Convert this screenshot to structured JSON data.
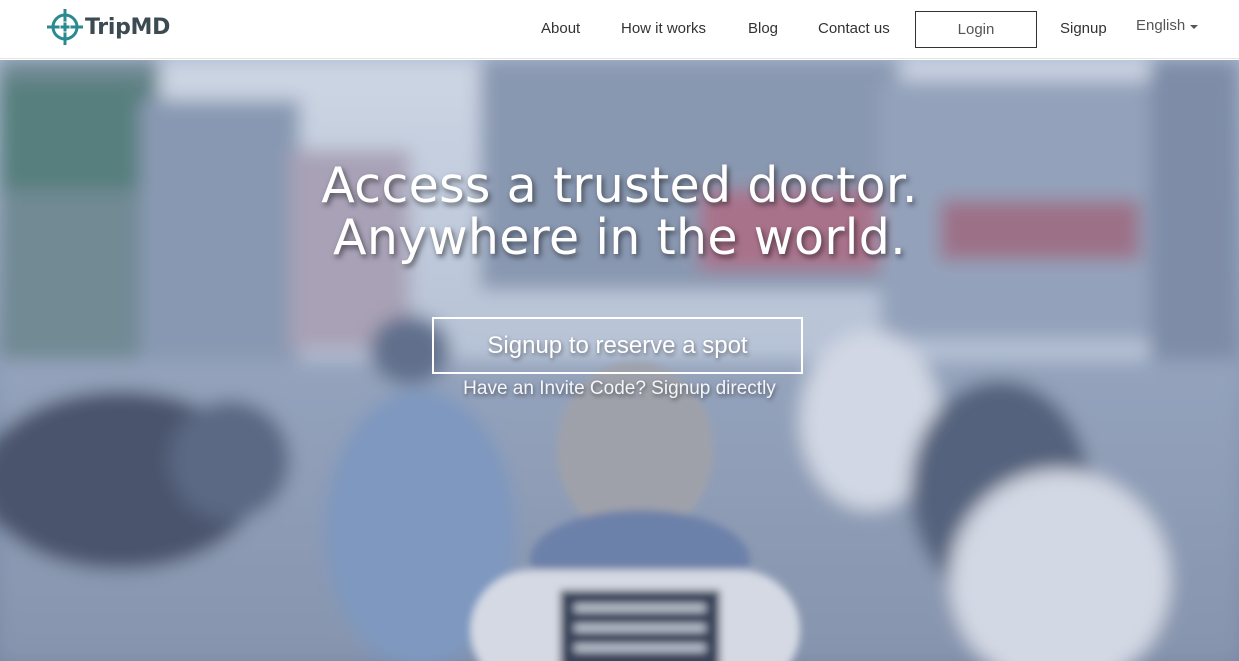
{
  "brand": {
    "name": "TripMD",
    "mark_color": "#2a8a8f",
    "text_color": "#3c4a52"
  },
  "nav": {
    "about": "About",
    "how_it_works": "How it works",
    "blog": "Blog",
    "contact": "Contact us",
    "login": "Login",
    "signup": "Signup",
    "language": "English"
  },
  "hero": {
    "headline_line1": "Access a trusted doctor.",
    "headline_line2": "Anywhere in the world.",
    "cta_label": "Signup to reserve a spot",
    "invite_text": "Have an Invite Code? Signup directly"
  },
  "icons": {
    "logo": "compass-cross-icon",
    "language_caret": "caret-down-icon"
  }
}
